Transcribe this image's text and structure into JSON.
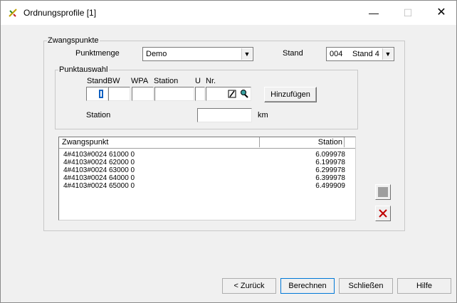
{
  "window": {
    "title": "Ordnungsprofile [1]"
  },
  "zwangspunkte": {
    "legend": "Zwangspunkte",
    "punktmenge_label": "Punktmenge",
    "punktmenge_value": "Demo",
    "stand_label": "Stand",
    "stand_code": "004",
    "stand_value": "Stand 4"
  },
  "punktauswahl": {
    "legend": "Punktauswahl",
    "col_standbw": "StandBW",
    "col_wpa": "WPA",
    "col_station": "Station",
    "col_u": "U",
    "col_nr": "Nr.",
    "add_button": "Hinzufügen",
    "station_label": "Station",
    "station_unit": "km"
  },
  "list": {
    "col_zwangspunkt": "Zwangspunkt",
    "col_station": "Station",
    "rows": [
      {
        "id": "4#4103#0024   61000   0",
        "station": "6.099978"
      },
      {
        "id": "4#4103#0024   62000   0",
        "station": "6.199978"
      },
      {
        "id": "4#4103#0024   63000   0",
        "station": "6.299978"
      },
      {
        "id": "4#4103#0024   64000   0",
        "station": "6.399978"
      },
      {
        "id": "4#4103#0024   65000   0",
        "station": "6.499909"
      }
    ]
  },
  "buttons": {
    "back": "< Zurück",
    "compute": "Berechnen",
    "close": "Schließen",
    "help": "Hilfe"
  },
  "icons": {
    "app": "ruler-pencil-icon",
    "selector": "pick-icon",
    "edit": "pencil-icon",
    "search": "magnifier-icon",
    "square": "square-icon",
    "delete": "delete-x-icon"
  },
  "colors": {
    "delete": "#c00000",
    "square": "#9e9e9e"
  }
}
